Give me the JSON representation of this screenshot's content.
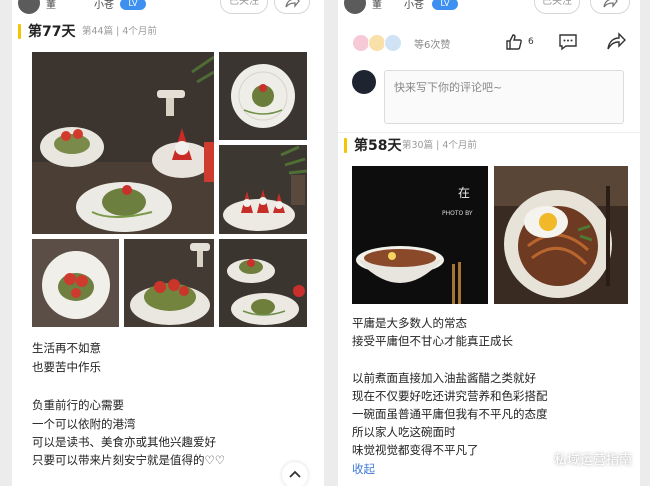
{
  "left_post": {
    "header": {
      "username": "董",
      "nickname": "小苍",
      "follow_label": "已关注"
    },
    "day_label": "第77天",
    "meta": "第44篇 | 4个月前",
    "text_lines": [
      "生活再不如意",
      "也要苦中作乐",
      "",
      "负重前行的心需要",
      "一个可以依附的港湾",
      "可以是读书、美食亦或其他兴趣爱好",
      "只要可以带来片刻安宁就是值得的♡♡"
    ]
  },
  "right_post": {
    "header": {
      "username": "董",
      "nickname": "小苍",
      "follow_label": "已关注"
    },
    "likes_text": "等6次赞",
    "like_count": "6",
    "comment_placeholder": "快来写下你的评论吧~",
    "day_label": "第58天",
    "meta": "第30篇 | 4个月前",
    "photo_caption_a": "在",
    "photo_caption_b": "PHOTO BY",
    "text_lines": [
      "平庸是大多数人的常态",
      "接受平庸但不甘心才能真正成长",
      "",
      "以前煮面直接加入油盐酱醋之类就好",
      "现在不仅要好吃还讲究营养和色彩搭配",
      "一碗面虽普通平庸但我有不平凡的态度",
      "所以家人吃这碗面时",
      "味觉视觉都变得不平凡了"
    ],
    "fold_label": "收起"
  },
  "watermark": "私域运营指南",
  "colors": {
    "accent_bar": "#f6c400",
    "link": "#3d7ad8",
    "badge": "#3d8ff0"
  }
}
